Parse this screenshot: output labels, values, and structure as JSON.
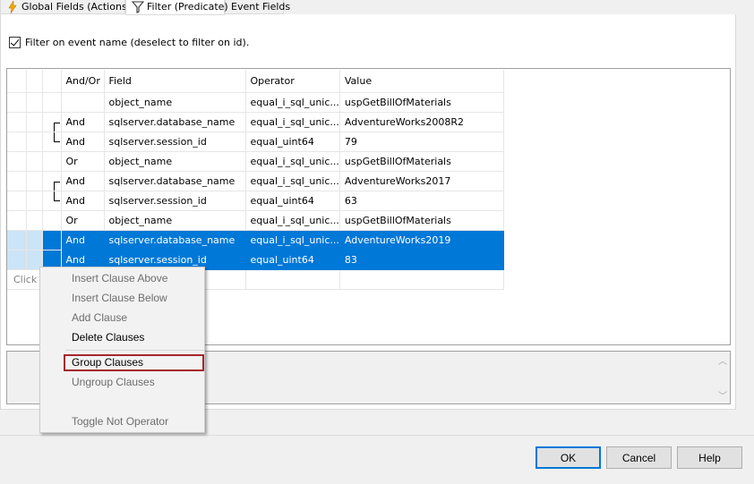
{
  "tabs": [
    {
      "label": "Global Fields (Actions)",
      "icon": "lightning-icon"
    },
    {
      "label": "Filter (Predicate)",
      "icon": "funnel-icon",
      "active": true
    },
    {
      "label": "Event Fields"
    }
  ],
  "filter_option": {
    "label": "Filter on event name (deselect to filter on id).",
    "checked": true
  },
  "grid": {
    "headers": [
      "And/Or",
      "Field",
      "Operator",
      "Value"
    ],
    "rows": [
      {
        "andor": "",
        "field": "object_name",
        "operator": "equal_i_sql_unic...",
        "value": "uspGetBillOfMaterials"
      },
      {
        "andor": "And",
        "field": "sqlserver.database_name",
        "operator": "equal_i_sql_unic...",
        "value": "AdventureWorks2008R2"
      },
      {
        "andor": "And",
        "field": "sqlserver.session_id",
        "operator": "equal_uint64",
        "value": "79"
      },
      {
        "andor": "Or",
        "field": "object_name",
        "operator": "equal_i_sql_unic...",
        "value": "uspGetBillOfMaterials"
      },
      {
        "andor": "And",
        "field": "sqlserver.database_name",
        "operator": "equal_i_sql_unic...",
        "value": "AdventureWorks2017"
      },
      {
        "andor": "And",
        "field": "sqlserver.session_id",
        "operator": "equal_uint64",
        "value": "63"
      },
      {
        "andor": "Or",
        "field": "object_name",
        "operator": "equal_i_sql_unic...",
        "value": "uspGetBillOfMaterials"
      },
      {
        "andor": "And",
        "field": "sqlserver.database_name",
        "operator": "equal_i_sql_unic...",
        "value": "AdventureWorks2019"
      },
      {
        "andor": "And",
        "field": "sqlserver.session_id",
        "operator": "equal_uint64",
        "value": "83"
      }
    ],
    "click_hint": "Click"
  },
  "context_menu": {
    "items": [
      "Insert Clause Above",
      "Insert Clause Below",
      "Add Clause",
      "Delete Clauses",
      "Group Clauses",
      "Ungroup Clauses",
      "Toggle Not Operator"
    ]
  },
  "buttons": {
    "ok": "OK",
    "cancel": "Cancel",
    "help": "Help"
  },
  "colors": {
    "selection": "#0078d7",
    "highlight_border": "#a4262c"
  }
}
